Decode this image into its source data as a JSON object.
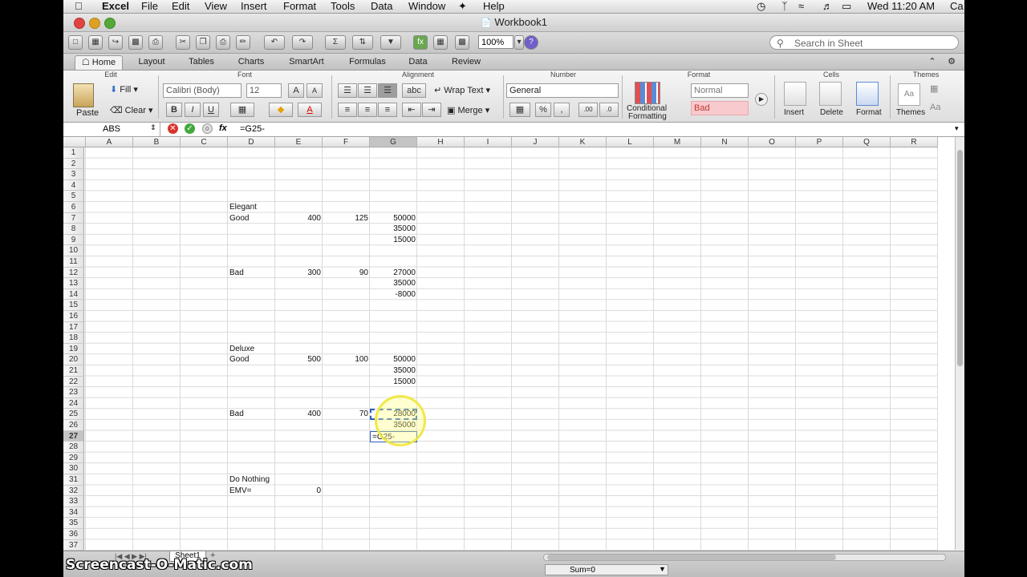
{
  "menubar": {
    "items": [
      "Excel",
      "File",
      "Edit",
      "View",
      "Insert",
      "Format",
      "Tools",
      "Data",
      "Window",
      "Help"
    ],
    "clock": "Wed 11:20 AM",
    "user": "Ca"
  },
  "window": {
    "title": "Workbook1"
  },
  "toolbar": {
    "zoom": "100%",
    "search_placeholder": "Search in Sheet"
  },
  "ribbon_tabs": [
    "Home",
    "Layout",
    "Tables",
    "Charts",
    "SmartArt",
    "Formulas",
    "Data",
    "Review"
  ],
  "ribbon": {
    "groups": [
      "Edit",
      "Font",
      "Alignment",
      "Number",
      "Format",
      "Cells",
      "Themes"
    ],
    "paste": "Paste",
    "fill": "Fill",
    "clear": "Clear",
    "font_name": "Calibri (Body)",
    "font_size": "12",
    "bold": "B",
    "italic": "I",
    "underline": "U",
    "wrap_text": "Wrap Text",
    "merge": "Merge",
    "number_format": "General",
    "percent": "%",
    "conditional_1": "Conditional",
    "conditional_2": "Formatting",
    "style_normal": "Normal",
    "style_bad": "Bad",
    "insert": "Insert",
    "delete": "Delete",
    "format": "Format",
    "themes": "Themes",
    "abc": "abc"
  },
  "formula_bar": {
    "name_box": "ABS",
    "fx": "fx",
    "formula": "=G25-"
  },
  "sheet": {
    "columns": [
      "A",
      "B",
      "C",
      "D",
      "E",
      "F",
      "G",
      "H",
      "I",
      "J",
      "K",
      "L",
      "M",
      "N",
      "O",
      "P",
      "Q",
      "R"
    ],
    "rows": [
      "1",
      "2",
      "3",
      "4",
      "5",
      "6",
      "7",
      "8",
      "9",
      "10",
      "11",
      "12",
      "13",
      "14",
      "15",
      "16",
      "17",
      "18",
      "19",
      "20",
      "21",
      "22",
      "23",
      "24",
      "25",
      "26",
      "27",
      "28",
      "29",
      "30",
      "31",
      "32",
      "33",
      "34",
      "35",
      "36",
      "37"
    ],
    "cells": {
      "D6": "Elegant",
      "D7": "Good",
      "E7": "400",
      "F7": "125",
      "G7": "50000",
      "G8": "35000",
      "G9": "15000",
      "D12": "Bad",
      "E12": "300",
      "F12": "90",
      "G12": "27000",
      "G13": "35000",
      "G14": "-8000",
      "D19": "Deluxe",
      "D20": "Good",
      "E20": "500",
      "F20": "100",
      "G20": "50000",
      "G21": "35000",
      "G22": "15000",
      "D25": "Bad",
      "E25": "400",
      "F25": "70",
      "G25": "28000",
      "G26": "35000",
      "G27": "=G25-",
      "D31": "Do Nothing",
      "D32": "EMV=",
      "E32": "0"
    },
    "active_cell": "G27",
    "sheet_tab": "Sheet1",
    "status": "Sum=0"
  },
  "watermark": "Screencast-O-Matic.com",
  "colors": {
    "selection": "#2b5fbf",
    "highlight": "#ffff66",
    "header_active": "#c9c9c9"
  }
}
